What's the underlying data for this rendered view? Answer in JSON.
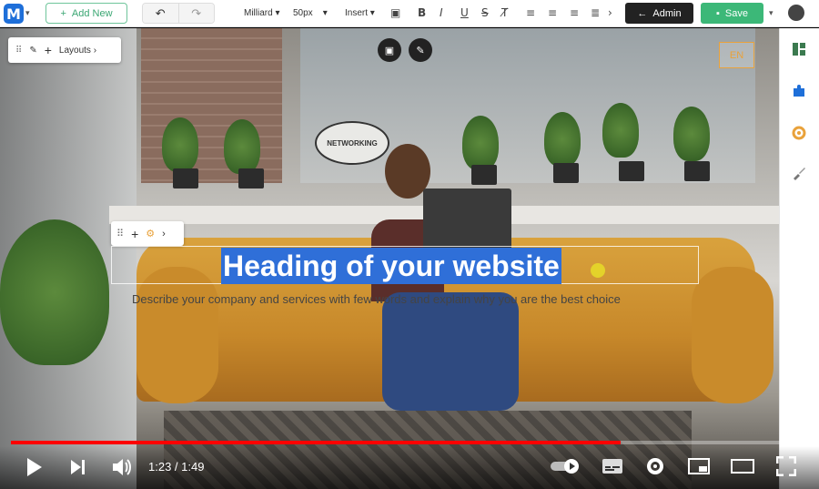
{
  "toolbar": {
    "add_new_label": "Add New",
    "font_family": "Milliard",
    "font_size": "50px",
    "insert_label": "Insert",
    "admin_label": "Admin",
    "save_label": "Save"
  },
  "editor": {
    "layouts_label": "Layouts",
    "language": "EN",
    "heading": "Heading of your website",
    "subtext": "Describe your company and services with few words and explain why you are the best choice"
  },
  "canvas_text": {
    "bubble": "NETWORKING"
  },
  "player": {
    "time_current": "1:23",
    "time_total": "1:49",
    "time_separator": " / ",
    "progress": 0.765
  },
  "colors": {
    "accent_blue": "#2f6fd8",
    "save_green": "#3cb878",
    "add_new_green": "#3aa672",
    "lang_orange": "#e9a23b",
    "progress_red": "#ff0000"
  }
}
